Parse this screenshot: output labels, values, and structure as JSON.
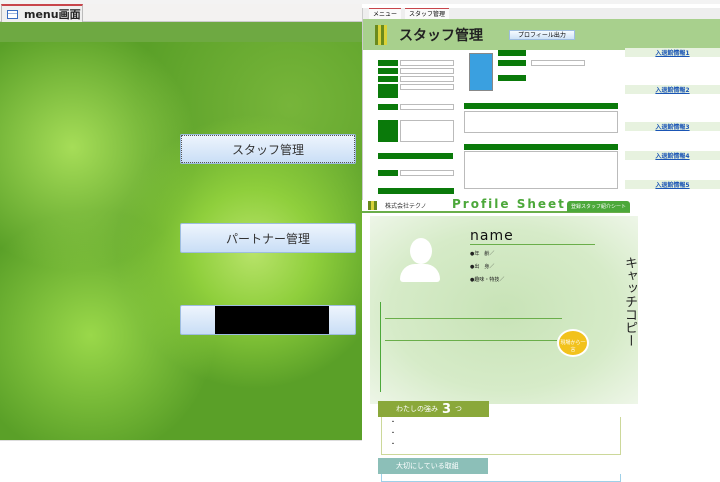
{
  "window": {
    "tab_label": "menu画面"
  },
  "menu": {
    "buttons": [
      {
        "label": "スタッフ管理"
      },
      {
        "label": "パートナー管理"
      },
      {
        "label": ""
      }
    ]
  },
  "staff_form": {
    "title": "スタッフ管理",
    "tabs": [
      "メニュー",
      "スタッフ管理"
    ],
    "header_button": "プロフィール出力"
  },
  "profile_sheet": {
    "company": "株式会社テクノ",
    "title": "Profile Sheet",
    "badge": "登録スタッフ紹介シート",
    "name": "name",
    "lines": [
      "●年　齢／",
      "●出　身／",
      "●趣味・特技／"
    ],
    "catch_copy": "キャッチコピー",
    "seal": "現場から一言",
    "strengths_label": "わたしの強み",
    "strengths_count": "3",
    "strengths_suffix": "つ",
    "values_label": "大切にしている取組",
    "bullets": [
      "・",
      "・",
      "・"
    ]
  },
  "right_panel": {
    "sections": [
      "入退館情報1",
      "入退館情報2",
      "入退館情報3",
      "入退館情報4",
      "入退館情報5"
    ]
  }
}
